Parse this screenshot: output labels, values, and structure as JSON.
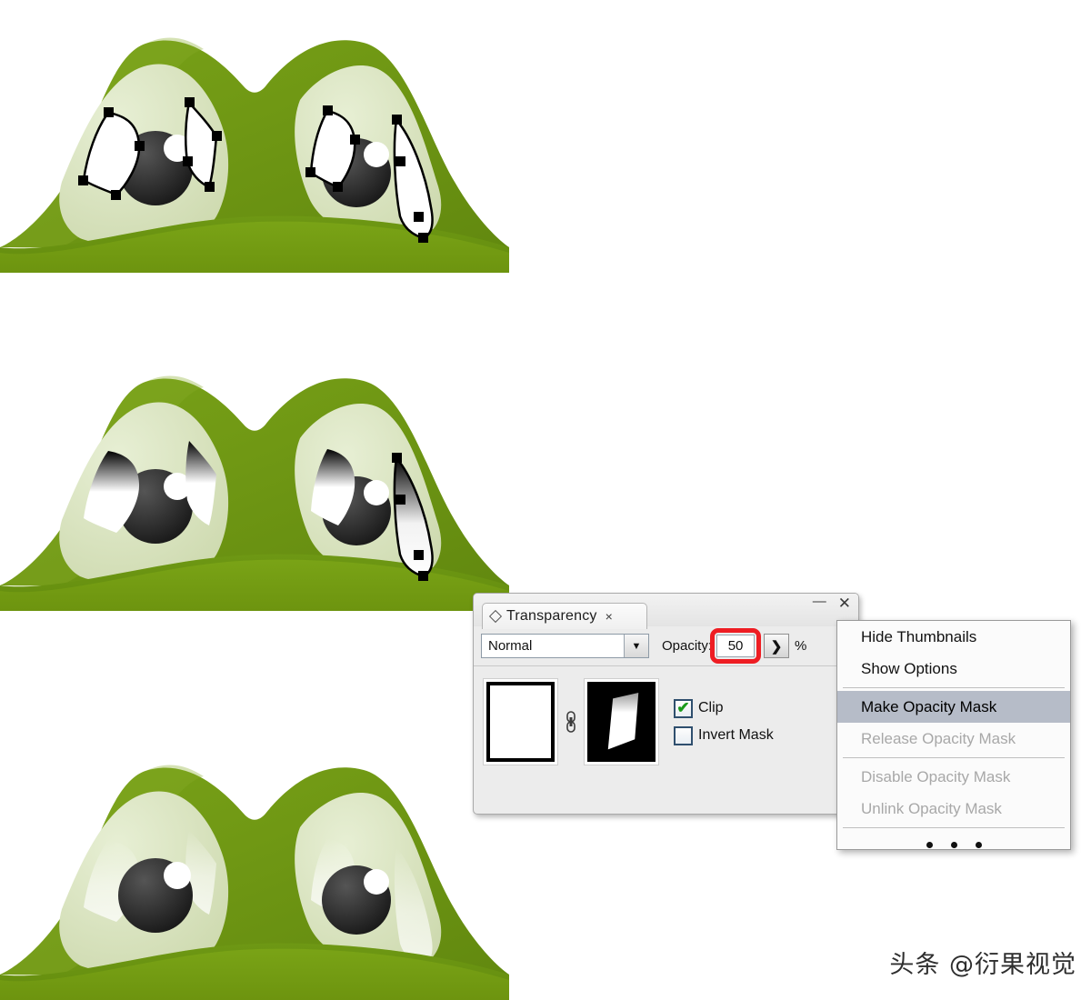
{
  "panel": {
    "tab": {
      "label": "Transparency",
      "icon": "diamond-icon",
      "close": "×"
    },
    "window": {
      "minimize": "—",
      "close": "✕"
    },
    "blend_mode": {
      "value": "Normal",
      "chevron": "❯"
    },
    "opacity": {
      "label": "Opacity:",
      "value": "50",
      "suffix": "%",
      "stepper": "❯"
    },
    "thumbnails": {
      "link_icon": "link-chain-icon",
      "object_thumb": "white-object-thumbnail",
      "mask_thumb": "gradient-opacity-mask-thumbnail"
    },
    "checkboxes": [
      {
        "label": "Clip",
        "checked": true,
        "tick": "✔"
      },
      {
        "label": "Invert Mask",
        "checked": false,
        "tick": ""
      }
    ]
  },
  "flyout_menu": {
    "items": [
      {
        "label": "Hide Thumbnails",
        "state": "normal"
      },
      {
        "label": "Show Options",
        "state": "normal"
      },
      {
        "label": "Make Opacity Mask",
        "state": "selected"
      },
      {
        "label": "Release Opacity Mask",
        "state": "disabled"
      },
      {
        "label": "Disable Opacity Mask",
        "state": "disabled"
      },
      {
        "label": "Unlink Opacity Mask",
        "state": "disabled"
      }
    ],
    "more_indicator": "• • •"
  },
  "illustrations": [
    {
      "name": "frog-step-1-paths-selected",
      "caption": ""
    },
    {
      "name": "frog-step-2-gradient-filled",
      "caption": ""
    },
    {
      "name": "frog-step-3-opacity-mask-applied",
      "caption": ""
    }
  ],
  "watermark": {
    "text": "头条 @衍果视觉"
  },
  "colors": {
    "head_green": "#6f9a14",
    "head_green_dark": "#5d8410",
    "socket_pale": "#d7e2bb",
    "socket_pale_light": "#e4ecd0",
    "pupil_dark": "#2b2b2b",
    "accent_red": "#ee1d23",
    "panel_gray": "#ececec",
    "menu_highlight": "#b6bcc8"
  }
}
